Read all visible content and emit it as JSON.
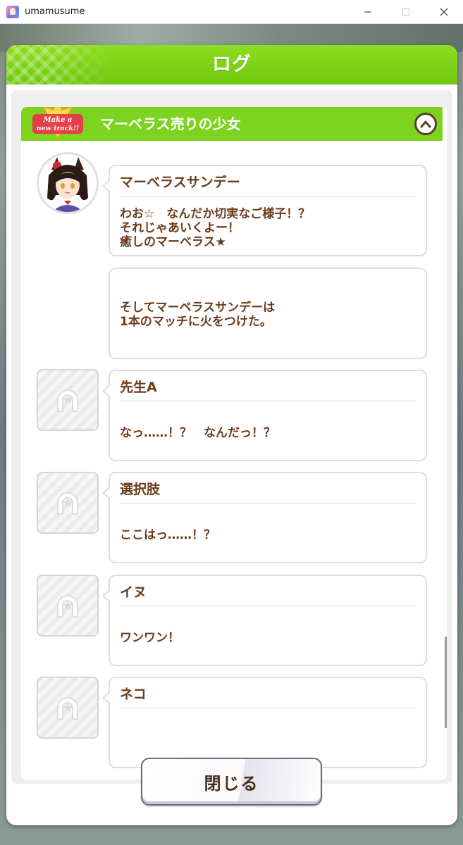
{
  "window": {
    "title": "umamusume",
    "minimize_glyph": "—",
    "maximize_glyph": "☐",
    "close_glyph": "✕"
  },
  "dialog": {
    "title": "ログ",
    "accent_color": "#7ed321",
    "text_color": "#6b3a1a",
    "close_label": "閉じる"
  },
  "chapter": {
    "title": "マーベラス売りの少女",
    "logo_line1": "Make a",
    "logo_line2": "new track!!",
    "expanded": true
  },
  "entries": [
    {
      "speaker": "マーベラスサンデー",
      "lines": [
        "わお☆　なんだか切実なご様子！？",
        "それじゃあいくよー！",
        "癒しのマーベラス★"
      ],
      "avatar": "character"
    },
    {
      "speaker": "",
      "lines": [
        "そしてマーベラスサンデーは",
        "1本のマッチに火をつけた。"
      ],
      "avatar": "none"
    },
    {
      "speaker": "先生A",
      "lines": [
        "なっ……！？　なんだっ！？"
      ],
      "avatar": "placeholder"
    },
    {
      "speaker": "選択肢",
      "lines": [
        "ここはっ……！？"
      ],
      "avatar": "placeholder"
    },
    {
      "speaker": "イヌ",
      "lines": [
        "ワンワン！"
      ],
      "avatar": "placeholder"
    },
    {
      "speaker": "ネコ",
      "lines": [],
      "avatar": "placeholder"
    }
  ]
}
